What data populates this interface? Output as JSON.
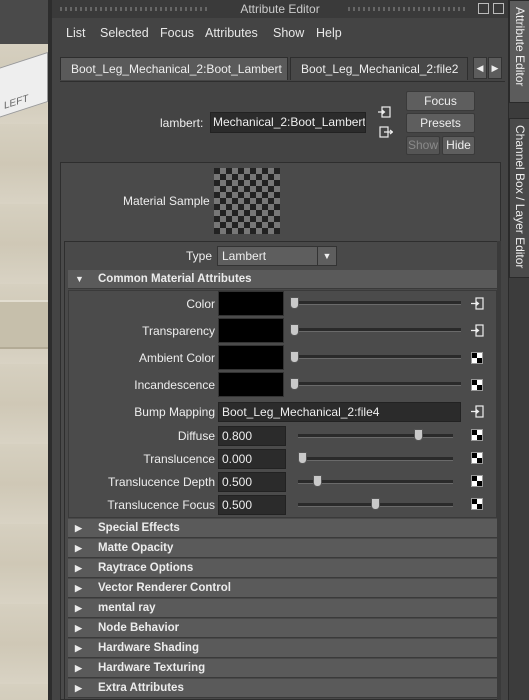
{
  "window": {
    "title": "Attribute Editor"
  },
  "viewport": {
    "cube_label": "LEFT"
  },
  "menu": [
    "List",
    "Selected",
    "Focus",
    "Attributes",
    "Show",
    "Help"
  ],
  "tabs": [
    {
      "label": "Boot_Leg_Mechanical_2:Boot_Lambert",
      "active": true
    },
    {
      "label": "Boot_Leg_Mechanical_2:file2",
      "active": false
    }
  ],
  "node": {
    "type_label": "lambert:",
    "name_value": "Mechanical_2:Boot_Lambert",
    "focus_label": "Focus",
    "presets_label": "Presets",
    "show_label": "Show",
    "hide_label": "Hide"
  },
  "material_sample": {
    "label": "Material Sample"
  },
  "type_selector": {
    "label": "Type",
    "value": "Lambert"
  },
  "common": {
    "header": "Common Material Attributes",
    "color_label": "Color",
    "transparency_label": "Transparency",
    "ambient_label": "Ambient Color",
    "incandescence_label": "Incandescence",
    "bump_label": "Bump Mapping",
    "bump_value": "Boot_Leg_Mechanical_2:file4",
    "diffuse_label": "Diffuse",
    "diffuse_value": "0.800",
    "translucence_label": "Translucence",
    "translucence_value": "0.000",
    "tdepth_label": "Translucence Depth",
    "tdepth_value": "0.500",
    "tfocus_label": "Translucence Focus",
    "tfocus_value": "0.500",
    "colors": {
      "color": "#000000",
      "transparency": "#000000",
      "ambient": "#000000",
      "incandescence": "#000000"
    }
  },
  "sections": [
    "Special Effects",
    "Matte Opacity",
    "Raytrace Options",
    "Vector Renderer Control",
    "mental ray",
    "Node Behavior",
    "Hardware Shading",
    "Hardware Texturing",
    "Extra Attributes"
  ],
  "side_tabs": [
    "Attribute Editor",
    "Channel Box / Layer Editor"
  ]
}
